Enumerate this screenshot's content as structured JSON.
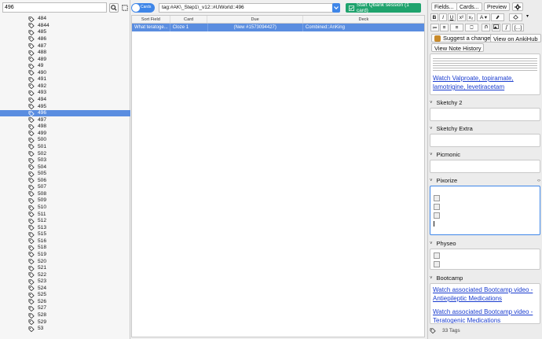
{
  "search": {
    "value": "496"
  },
  "tags": [
    "484",
    "4844",
    "485",
    "486",
    "487",
    "488",
    "489",
    "49",
    "490",
    "491",
    "492",
    "493",
    "494",
    "495",
    "496",
    "497",
    "498",
    "499",
    "500",
    "501",
    "502",
    "503",
    "504",
    "505",
    "506",
    "507",
    "508",
    "509",
    "510",
    "511",
    "512",
    "513",
    "515",
    "516",
    "518",
    "519",
    "520",
    "521",
    "522",
    "523",
    "524",
    "525",
    "526",
    "527",
    "528",
    "529",
    "53"
  ],
  "selected_tag": "496",
  "toolbar": {
    "toggle_label": "Cards",
    "query": "tag:#AK\\_Step1\\_v12::#UWorld::496",
    "qbank_button": "Start Qbank session (1 card)"
  },
  "table": {
    "headers": [
      "Sort Field",
      "Card",
      "Due",
      "Deck"
    ],
    "rows": [
      [
        "What teratoge...",
        "Cloze 1",
        "(New #1573094427)",
        "Combined::AnKing"
      ]
    ]
  },
  "editor": {
    "top_buttons": [
      "Fields...",
      "Cards...",
      "Preview"
    ],
    "format_row1": [
      "B",
      "I",
      "U",
      "x²",
      "x₂",
      "A"
    ],
    "format_row2": [
      "≔",
      "≡",
      "≡",
      "⎕",
      "[...]"
    ],
    "suggest_button": "Suggest a change",
    "view_ankihub_button": "View on AnkiHub",
    "history_button": "View Note History",
    "top_field_link": "Watch Valproate, topiramate, lamotrigine, levetiracetam",
    "fields": [
      {
        "name": "Sketchy 2"
      },
      {
        "name": "Sketchy Extra"
      },
      {
        "name": "Picmonic"
      },
      {
        "name": "Pixorize"
      },
      {
        "name": "Physeo"
      },
      {
        "name": "Bootcamp"
      }
    ],
    "bootcamp_link1": "Watch associated Bootcamp video - Antiepileptic Medications",
    "bootcamp_link2": "Watch associated Bootcamp video - Teratogenic Medications",
    "tags_count": "33 Tags"
  },
  "colors": {
    "accent": "#3f86e8",
    "selection": "#5a8de0",
    "qbank": "#1fa36d",
    "link": "#1a3ccf"
  }
}
